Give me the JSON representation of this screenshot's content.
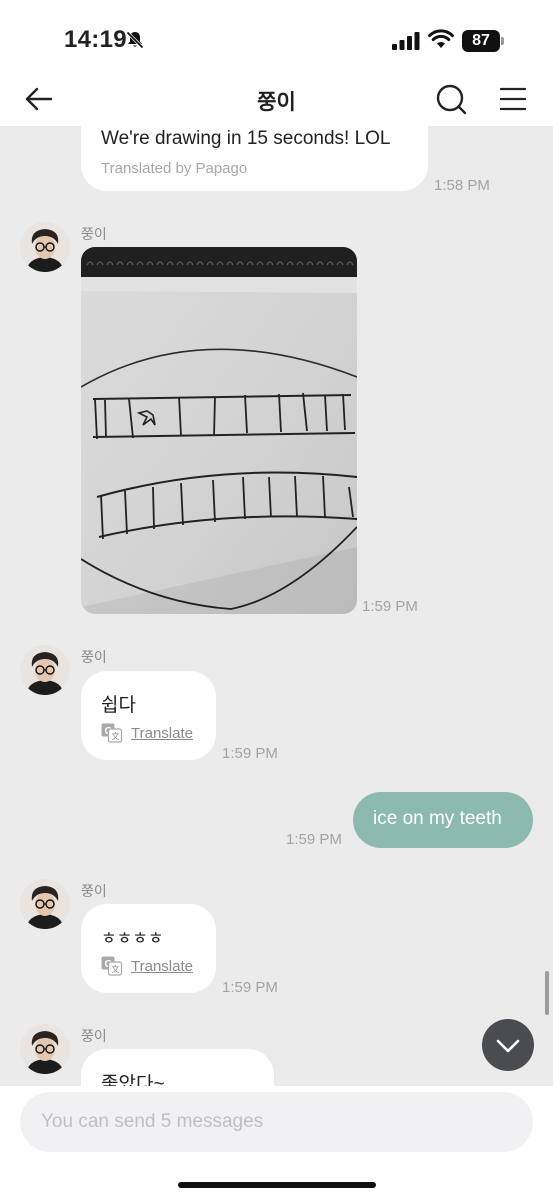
{
  "status_bar": {
    "time": "14:19",
    "battery": "87",
    "icons": [
      "bell-slash-icon",
      "signal-icon",
      "wifi-icon",
      "battery-icon"
    ]
  },
  "header": {
    "title": "쭝이",
    "icons": [
      "back-arrow-icon",
      "search-icon",
      "menu-icon"
    ]
  },
  "messages": [
    {
      "direction": "in",
      "text": "We're drawing in 15 seconds! LOL",
      "note": "Translated by Papago",
      "time": "1:58 PM"
    },
    {
      "direction": "in",
      "sender": "쭝이",
      "type": "image",
      "time": "1:59 PM"
    },
    {
      "direction": "in",
      "sender": "쭝이",
      "text": "쉽다",
      "action": "Translate",
      "time": "1:59 PM"
    },
    {
      "direction": "out",
      "text": "ice on my teeth",
      "time": "1:59 PM"
    },
    {
      "direction": "in",
      "sender": "쭝이",
      "text": "ㅎㅎㅎㅎ",
      "action": "Translate",
      "time": "1:59 PM"
    },
    {
      "direction": "in",
      "sender": "쭝이",
      "text": "좋았다~"
    }
  ],
  "composer": {
    "placeholder": "You can send 5 messages"
  },
  "colors": {
    "background": "#ebebeb",
    "incoming_bubble": "#ffffff",
    "outgoing_bubble": "#8dbab0",
    "timestamp": "#a3a3a3",
    "scroll_button": "#4a4c52"
  }
}
